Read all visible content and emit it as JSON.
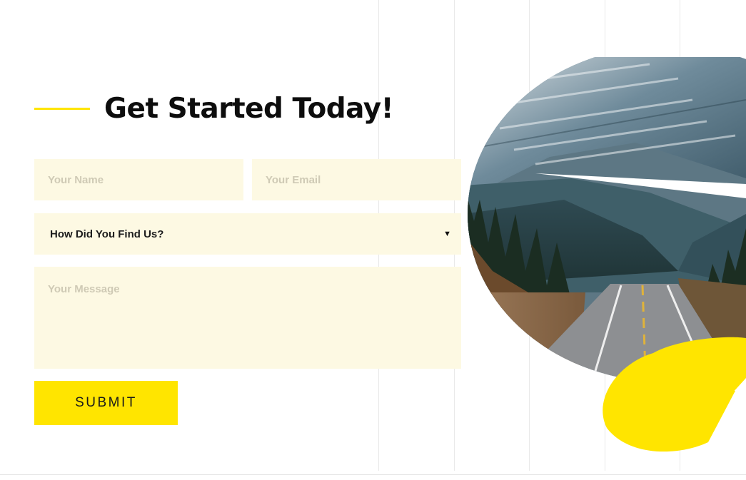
{
  "header": {
    "title": "Get Started Today!"
  },
  "form": {
    "name": {
      "value": "",
      "placeholder": "Your Name"
    },
    "email": {
      "value": "",
      "placeholder": "Your Email"
    },
    "source": {
      "selected": "How Did You Find Us?"
    },
    "message": {
      "value": "",
      "placeholder": "Your Message"
    },
    "submit_label": "SUBMIT"
  },
  "colors": {
    "accent": "#ffe500",
    "field_bg": "#fdf9e3",
    "text": "#0d0d0d"
  },
  "icons": {
    "select_caret": "chevron-down-icon"
  }
}
